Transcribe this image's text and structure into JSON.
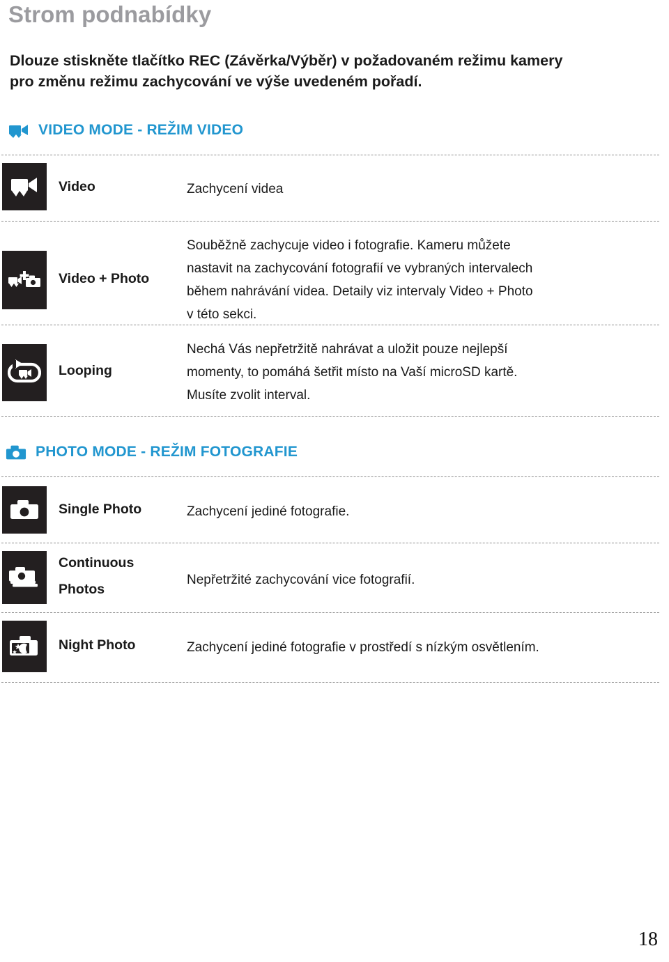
{
  "page": {
    "title": "Strom podnabídky",
    "number": "18",
    "accent_blue": "#2196cf",
    "title_gray": "#9b9b9f",
    "icon_tile_dark": "#231f20"
  },
  "intro": {
    "lines": [
      "Dlouze stiskněte tlačítko REC (Závěrka/Výběr) v požadovaném režimu kamery",
      "pro změnu režimu zachycování ve výše uvedeném pořadí."
    ]
  },
  "sections": [
    {
      "id": "video-mode",
      "icon": "video-camera-icon",
      "label": "VIDEO MODE - REŽIM VIDEO",
      "rows": [
        {
          "id": "video",
          "icon": "video-camera-icon",
          "label_lines": [
            "Video"
          ],
          "desc_lines": [
            "Zachycení videa"
          ]
        },
        {
          "id": "video-photo",
          "icon": "video-plus-photo-icon",
          "label_lines": [
            "Video + Photo"
          ],
          "desc_lines": [
            "Souběžně zachycuje video i fotografie. Kameru můžete",
            "nastavit na zachycování fotografií ve vybraných intervalech",
            "během nahrávání videa. Detaily viz intervaly Video + Photo",
            "v této sekci."
          ]
        },
        {
          "id": "looping",
          "icon": "looping-video-icon",
          "label_lines": [
            "Looping"
          ],
          "desc_lines": [
            "Nechá Vás nepřetržitě nahrávat a uložit pouze nejlepší",
            "momenty, to pomáhá šetřit místo na Vaší microSD kartě.",
            "Musíte zvolit interval."
          ]
        }
      ]
    },
    {
      "id": "photo-mode",
      "icon": "photo-camera-icon",
      "label": "PHOTO MODE - REŽIM FOTOGRAFIE",
      "rows": [
        {
          "id": "single-photo",
          "icon": "photo-camera-icon",
          "label_lines": [
            "Single Photo"
          ],
          "desc_lines": [
            "Zachycení jediné fotografie."
          ]
        },
        {
          "id": "continuous-photos",
          "icon": "burst-photos-icon",
          "label_lines": [
            "Continuous",
            "Photos"
          ],
          "desc_lines": [
            "Nepřetržité zachycování vice fotografií."
          ]
        },
        {
          "id": "night-photo",
          "icon": "night-photo-icon",
          "label_lines": [
            "Night Photo"
          ],
          "desc_lines": [
            "Zachycení jediné fotografie v prostředí s nízkým osvětlením."
          ]
        }
      ]
    }
  ]
}
